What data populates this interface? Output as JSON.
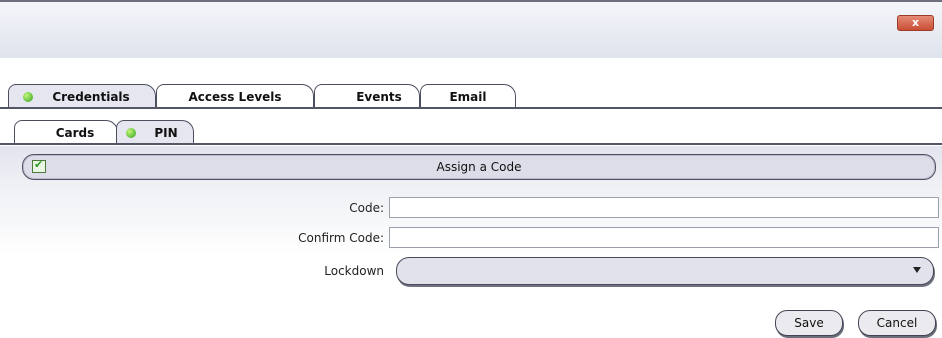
{
  "window": {
    "close_label": "x"
  },
  "tabs": {
    "primary": [
      {
        "label": "Credentials",
        "status": "green"
      },
      {
        "label": "Access Levels"
      },
      {
        "label": "Events"
      },
      {
        "label": "Email"
      }
    ],
    "secondary": [
      {
        "label": "Cards"
      },
      {
        "label": "PIN",
        "status": "green"
      }
    ]
  },
  "assign_section": {
    "label": "Assign a Code",
    "checked": true
  },
  "form": {
    "code_label": "Code:",
    "code_value": "",
    "confirm_label": "Confirm Code:",
    "confirm_value": "",
    "lockdown_label": "Lockdown",
    "lockdown_value": ""
  },
  "buttons": {
    "save": "Save",
    "cancel": "Cancel"
  },
  "colors": {
    "status_green": "#3fa52b",
    "close_red": "#c94f35",
    "border_dark": "#4c4f60"
  }
}
